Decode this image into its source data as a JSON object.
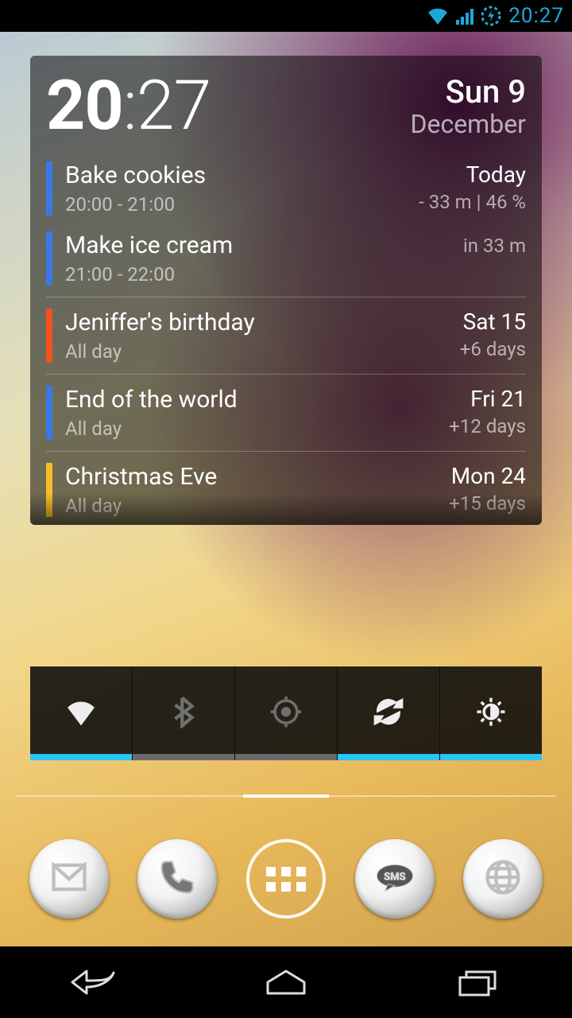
{
  "status": {
    "time": "20:27"
  },
  "widget": {
    "hours": "20",
    "colon": ":",
    "minutes": "27",
    "day_date": "Sun 9",
    "month": "December"
  },
  "events": [
    {
      "group": 0,
      "color": "#3b78e7",
      "title": "Bake cookies",
      "sub": "20:00 - 21:00",
      "rtitle": "Today",
      "rsub": "- 33 m | 46 %"
    },
    {
      "group": 0,
      "color": "#3b78e7",
      "title": "Make ice cream",
      "sub": "21:00 - 22:00",
      "rtitle": "",
      "rsub": "in 33 m"
    },
    {
      "group": 1,
      "color": "#f4511e",
      "title": "Jeniffer's birthday",
      "sub": "All day",
      "rtitle": "Sat 15",
      "rsub": "+6 days"
    },
    {
      "group": 2,
      "color": "#3b78e7",
      "title": "End of the world",
      "sub": "All day",
      "rtitle": "Fri 21",
      "rsub": "+12 days"
    },
    {
      "group": 3,
      "color": "#f6bf26",
      "title": "Christmas Eve",
      "sub": "All day",
      "rtitle": "Mon 24",
      "rsub": "+15 days"
    }
  ],
  "power_toggles": [
    {
      "name": "wifi",
      "state": "on"
    },
    {
      "name": "bluetooth",
      "state": "off"
    },
    {
      "name": "gps",
      "state": "off"
    },
    {
      "name": "sync",
      "state": "on"
    },
    {
      "name": "brightness",
      "state": "on"
    }
  ],
  "dock": [
    {
      "name": "gmail",
      "label": "M"
    },
    {
      "name": "phone",
      "label": ""
    },
    {
      "name": "apps",
      "label": ""
    },
    {
      "name": "sms",
      "label": "SMS"
    },
    {
      "name": "browser",
      "label": ""
    }
  ]
}
